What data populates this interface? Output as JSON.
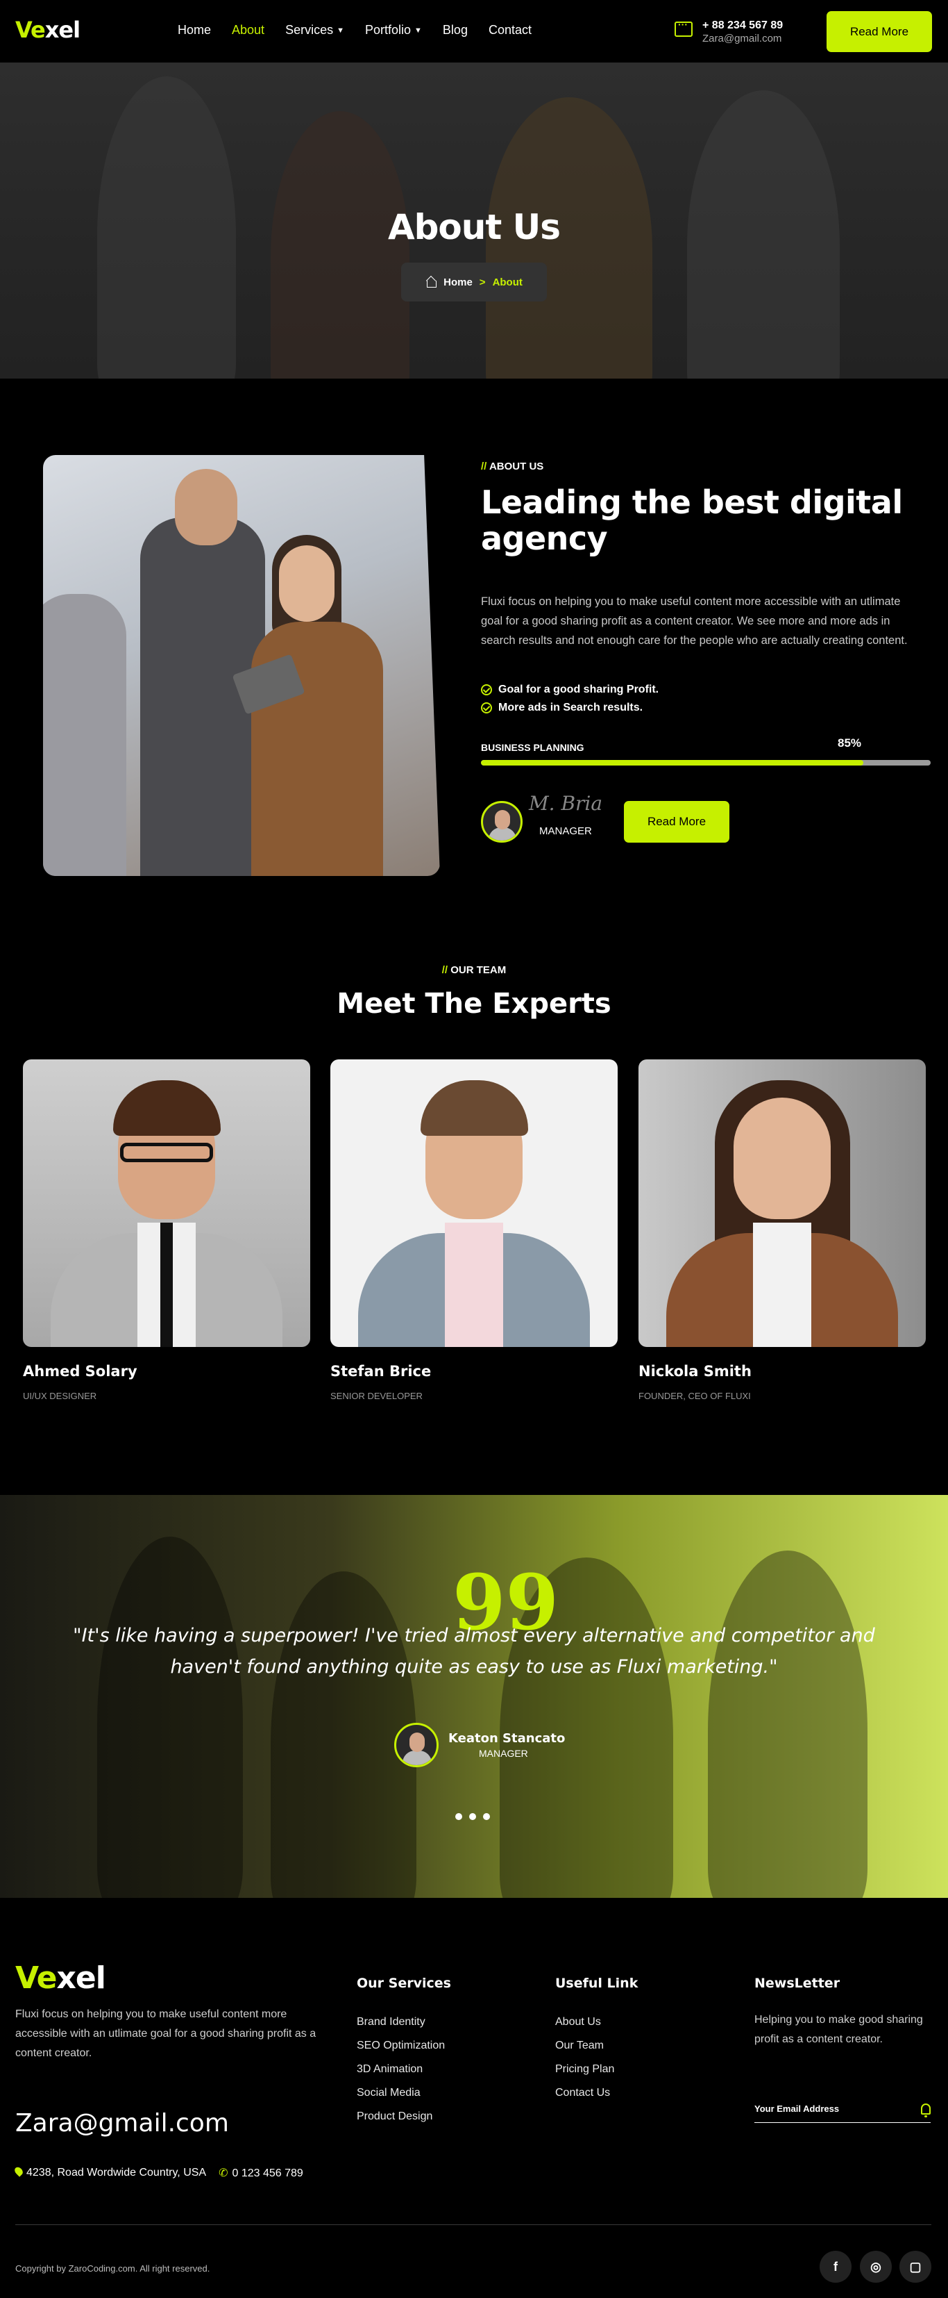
{
  "header": {
    "logo_accent": "Ve",
    "logo_rest": "xel",
    "nav": [
      {
        "label": "Home"
      },
      {
        "label": "About"
      },
      {
        "label": "Services"
      },
      {
        "label": "Portfolio"
      },
      {
        "label": "Blog"
      },
      {
        "label": "Contact"
      }
    ],
    "phone": "+ 88 234 567 89",
    "email": "Zara@gmail.com",
    "cta": "Read More"
  },
  "hero": {
    "title": "About Us",
    "breadcrumb_home": "Home",
    "breadcrumb_sep": ">",
    "breadcrumb_current": "About"
  },
  "about": {
    "tag_slash": "//",
    "tag": "ABOUT US",
    "heading": "Leading the best digital agency",
    "paragraph": "Fluxi focus on helping you to make useful content more accessible with an utlimate goal for a good sharing profit as a content creator. We see more and more ads in search results and not enough care for the people who are actually creating content.",
    "checks": [
      "Goal for a good sharing Profit.",
      "More ads in Search results."
    ],
    "progress_label": "BUSINESS PLANNING",
    "progress_text": "85%",
    "progress_value": 0.85,
    "signature": "M. Bria",
    "manager": "MANAGER",
    "cta": "Read More"
  },
  "team": {
    "tag_slash": "//",
    "tag": "OUR TEAM",
    "heading": "Meet The Experts",
    "members": [
      {
        "name": "Ahmed Solary",
        "role": "UI/UX DESIGNER"
      },
      {
        "name": "Stefan Brice",
        "role": "SENIOR DEVELOPER"
      },
      {
        "name": "Nickola Smith",
        "role": "FOUNDER, CEO OF FLUXI"
      }
    ]
  },
  "testimonial": {
    "quote_mark": "99",
    "quote": "\"It's like having a superpower! I've tried almost every alternative and competitor and haven't found anything quite as easy to use as Fluxi marketing.\"",
    "name": "Keaton Stancato",
    "role": "MANAGER"
  },
  "footer": {
    "logo_accent": "Ve",
    "logo_rest": "xel",
    "about": "Fluxi focus on helping you to make useful content more accessible with an utlimate goal for a good sharing profit as a content creator.",
    "email": "Zara@gmail.com",
    "address": "4238, Road Wordwide Country, USA",
    "phone": "0 123 456 789",
    "services_title": "Our Services",
    "services": [
      "Brand Identity",
      "SEO Optimization",
      "3D Animation",
      "Social Media",
      "Product Design"
    ],
    "links_title": "Useful Link",
    "links": [
      "About Us",
      "Our Team",
      "Pricing Plan",
      "Contact Us"
    ],
    "newsletter_title": "NewsLetter",
    "newsletter_text": "Helping you to make  good sharing profit as a content creator.",
    "newsletter_placeholder": "Your Email Address",
    "copyright": "Copyright by ZaroCoding.com. All right reserved."
  },
  "colors": {
    "accent": "#c6f000",
    "background": "#000000"
  }
}
